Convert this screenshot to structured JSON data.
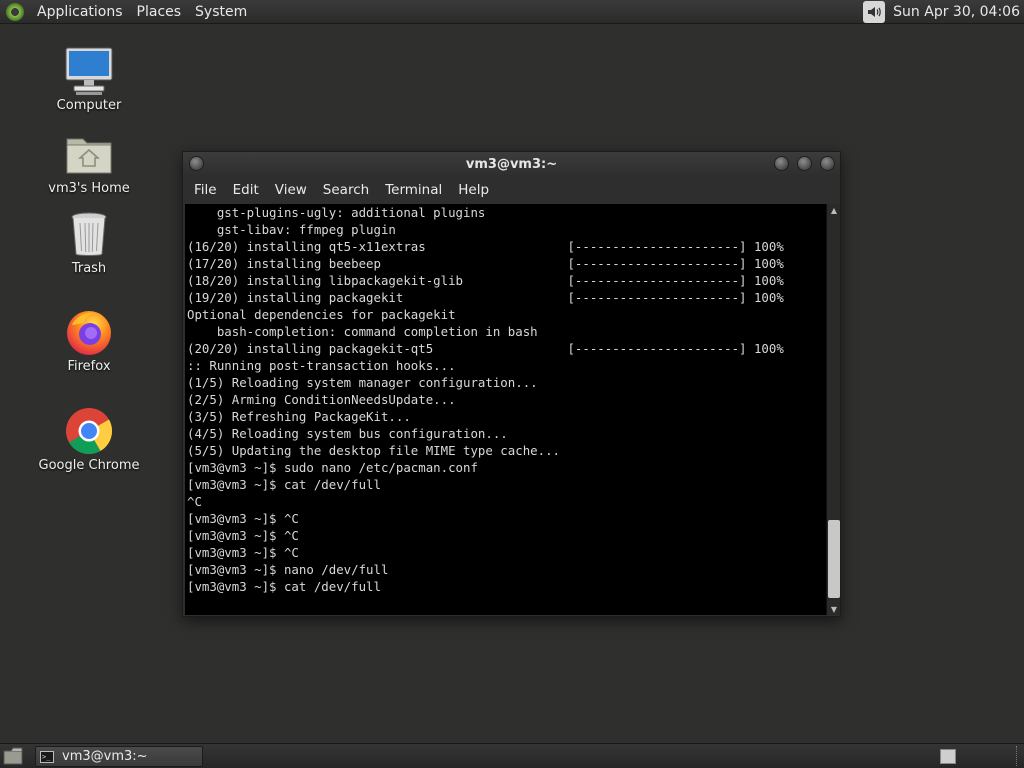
{
  "top_panel": {
    "menus": [
      "Applications",
      "Places",
      "System"
    ],
    "clock": "Sun Apr 30, 04:06"
  },
  "desktop": {
    "icons": [
      {
        "label": "Computer",
        "icon": "computer-icon"
      },
      {
        "label": "vm3's Home",
        "icon": "home-folder-icon"
      },
      {
        "label": "Trash",
        "icon": "trash-icon"
      },
      {
        "label": "Firefox",
        "icon": "firefox-icon"
      },
      {
        "label": "Google Chrome",
        "icon": "chrome-icon"
      }
    ]
  },
  "terminal": {
    "title": "vm3@vm3:~",
    "menus": [
      "File",
      "Edit",
      "View",
      "Search",
      "Terminal",
      "Help"
    ],
    "lines": [
      "    gst-plugins-ugly: additional plugins",
      "    gst-libav: ffmpeg plugin",
      "(16/20) installing qt5-x11extras                   [----------------------] 100%",
      "(17/20) installing beebeep                         [----------------------] 100%",
      "(18/20) installing libpackagekit-glib              [----------------------] 100%",
      "(19/20) installing packagekit                      [----------------------] 100%",
      "Optional dependencies for packagekit",
      "    bash-completion: command completion in bash",
      "(20/20) installing packagekit-qt5                  [----------------------] 100%",
      ":: Running post-transaction hooks...",
      "(1/5) Reloading system manager configuration...",
      "(2/5) Arming ConditionNeedsUpdate...",
      "(3/5) Refreshing PackageKit...",
      "(4/5) Reloading system bus configuration...",
      "(5/5) Updating the desktop file MIME type cache...",
      "[vm3@vm3 ~]$ sudo nano /etc/pacman.conf",
      "[vm3@vm3 ~]$ cat /dev/full",
      "^C",
      "[vm3@vm3 ~]$ ^C",
      "[vm3@vm3 ~]$ ^C",
      "[vm3@vm3 ~]$ ^C",
      "[vm3@vm3 ~]$ nano /dev/full",
      "[vm3@vm3 ~]$ cat /dev/full"
    ]
  },
  "taskbar": {
    "window_button": "vm3@vm3:~"
  },
  "colors": {
    "desktop_bg": "#2f302d",
    "terminal_bg": "#000000",
    "terminal_fg": "#d8d8d8"
  }
}
